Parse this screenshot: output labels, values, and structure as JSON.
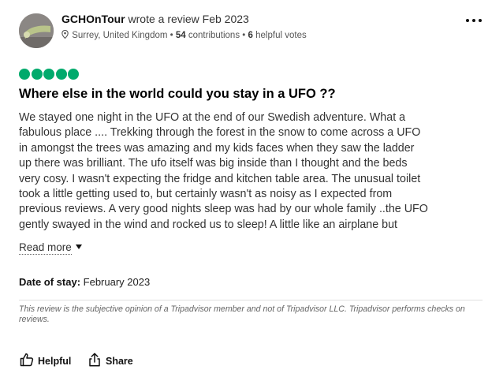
{
  "author": {
    "name": "GCHOnTour",
    "action": "wrote a review Feb 2023",
    "location": "Surrey, United Kingdom",
    "contributions_count": "54",
    "contributions_label": "contributions",
    "helpful_count": "6",
    "helpful_label": "helpful votes",
    "separator": "•"
  },
  "rating": {
    "bubbles": 5,
    "max": 5,
    "color": "#00aa6c"
  },
  "review": {
    "title": "Where else in the world could you stay in a UFO ??",
    "body_lines": [
      "We stayed one night in the UFO at the end of our Swedish adventure. What a",
      "fabulous place .... Trekking through the forest in the snow to come across a UFO",
      "in amongst the trees was amazing and my kids faces when they saw the ladder",
      "up there was brilliant. The ufo itself was big inside than I thought and the beds",
      "very cosy. I wasn't expecting the fridge and kitchen table area. The unusual toilet",
      "took a little getting used to, but certainly wasn't as noisy as I expected from",
      "previous reviews. A very good nights sleep was had by our whole family ..the UFO",
      "gently swayed in the wind and rocked us to sleep! A little like an airplane but"
    ],
    "read_more": "Read more",
    "date_of_stay_label": "Date of stay:",
    "date_of_stay_value": "February 2023"
  },
  "disclaimer": "This review is the subjective opinion of a Tripadvisor member and not of Tripadvisor LLC. Tripadvisor performs checks on reviews.",
  "actions": {
    "helpful": "Helpful",
    "share": "Share"
  },
  "icons": {
    "location": "map-pin-icon",
    "more": "more-options-icon",
    "helpful": "thumbs-up-icon",
    "share": "share-icon",
    "read_more": "chevron-down-icon"
  }
}
